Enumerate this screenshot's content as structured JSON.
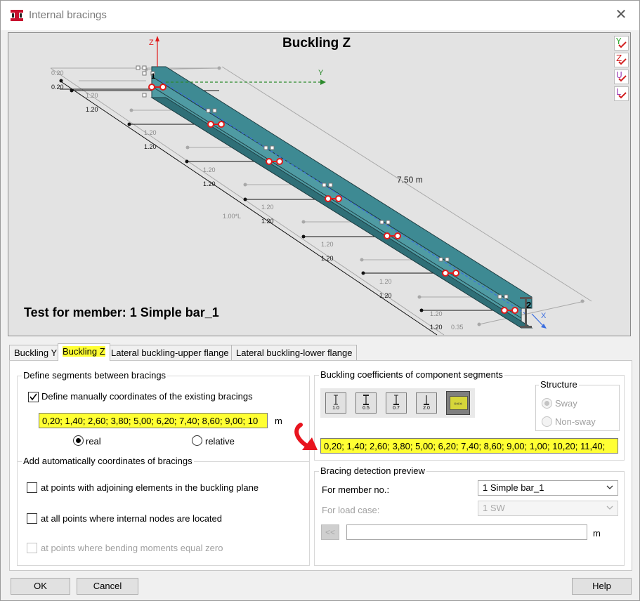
{
  "window": {
    "title": "Internal bracings",
    "close_symbol": "✕"
  },
  "preview": {
    "view_title": "Buckling Z",
    "member_caption": "Test for member: 1 Simple bar_1",
    "length_label": "7.50  m",
    "axis_z": "Z",
    "axis_y": "Y",
    "axis_x": "X",
    "member_end_number": "2",
    "member_start_number": "1",
    "factor_label": "1.00*L",
    "end_label": "0.35",
    "top_dims": [
      "0.20",
      "0.20"
    ],
    "segment_dims": [
      "1.20",
      "1.20",
      "1.20",
      "1.20",
      "1.20",
      "1.20",
      "1.20"
    ],
    "view_buttons": [
      {
        "label": "Y",
        "color": "#2aa52a"
      },
      {
        "label": "Z",
        "color": "#d21e1e"
      },
      {
        "label": "U",
        "color": "#9b3cb4"
      },
      {
        "label": "L",
        "color": "#9b3cb4"
      }
    ]
  },
  "tabs": [
    "Buckling Y",
    "Buckling Z",
    "Lateral buckling-upper flange",
    "Lateral buckling-lower flange"
  ],
  "active_tab": "Buckling Z",
  "define_group": {
    "title": "Define segments between bracings",
    "manual_checkbox_label": "Define manually coordinates of the existing bracings",
    "manual_checked": true,
    "coords_value": "0,20; 1,40; 2,60; 3,80; 5,00; 6,20; 7,40; 8,60; 9,00; 10",
    "unit": "m",
    "radio_real": "real",
    "radio_relative": "relative",
    "selected": "real"
  },
  "auto_group": {
    "title": "Add automatically coordinates of bracings",
    "options": [
      {
        "label": "at points with adjoining elements in the buckling plane",
        "checked": false,
        "enabled": true
      },
      {
        "label": "at all points where internal nodes are located",
        "checked": false,
        "enabled": true
      },
      {
        "label": "at points where bending moments equal zero",
        "checked": false,
        "enabled": false
      }
    ]
  },
  "coeff_group": {
    "title": "Buckling coefficients of component segments",
    "buttons": [
      "1.0",
      "0.5",
      "0.7",
      "2.0",
      "»»»"
    ],
    "coeffs_value": "0,20; 1,40; 2,60; 3,80; 5,00; 6,20; 7,40; 8,60; 9,00; 1,00; 10,20; 11,40;"
  },
  "structure": {
    "title": "Structure",
    "sway": "Sway",
    "non_sway": "Non-sway",
    "selected": "Sway"
  },
  "preview_group": {
    "title": "Bracing detection preview",
    "member_label": "For member no.:",
    "member_value": "1  Simple bar_1",
    "loadcase_label": "For load case:",
    "loadcase_value": "1  SW",
    "back_button": "<<",
    "input_value": "",
    "unit": "m"
  },
  "footer": {
    "ok": "OK",
    "cancel": "Cancel",
    "help": "Help"
  }
}
